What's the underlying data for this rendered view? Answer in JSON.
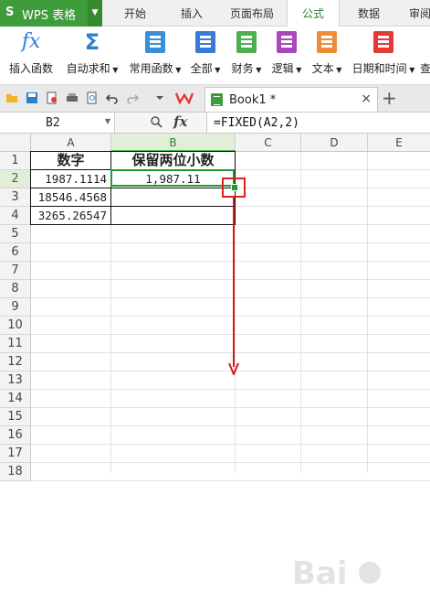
{
  "app": {
    "brand": "WPS 表格",
    "brand_logo": "S",
    "accent": "#3e9c3a"
  },
  "tabs": [
    "开始",
    "插入",
    "页面布局",
    "公式",
    "数据",
    "审阅"
  ],
  "active_tab": "公式",
  "ribbon": [
    {
      "label": "插入函数",
      "icon": "fx-icon",
      "has_dropdown": false,
      "color": "#2f7fd1"
    },
    {
      "label": "自动求和",
      "icon": "sigma-icon",
      "has_dropdown": true,
      "color": "#2f7fd1"
    },
    {
      "label": "常用函数",
      "icon": "star-book-icon",
      "has_dropdown": true,
      "color": "#3a8fd9"
    },
    {
      "label": "全部",
      "icon": "all-functions-icon",
      "has_dropdown": true,
      "color": "#3a7bd5"
    },
    {
      "label": "财务",
      "icon": "finance-icon",
      "has_dropdown": true,
      "color": "#4caf50"
    },
    {
      "label": "逻辑",
      "icon": "logic-icon",
      "has_dropdown": true,
      "color": "#ab47bc"
    },
    {
      "label": "文本",
      "icon": "text-icon",
      "has_dropdown": true,
      "color": "#ef8c3b"
    },
    {
      "label": "日期和时间",
      "icon": "clock-icon",
      "has_dropdown": true,
      "color": "#e53935"
    },
    {
      "label": "查",
      "icon": "lookup-icon",
      "has_dropdown": false,
      "color": "#2f7fd1"
    }
  ],
  "quick_access_icons": [
    "folder-icon",
    "save-icon",
    "print-preview-icon",
    "print-icon",
    "preview-icon",
    "undo-icon",
    "redo-icon",
    "customize-dropdown-icon",
    "wps-logo-icon"
  ],
  "document_tab": {
    "name": "Book1 *",
    "close": "×",
    "new_tab": "+"
  },
  "formula_bar": {
    "cell_ref": "B2",
    "formula": "=FIXED(A2,2)"
  },
  "sheet": {
    "columns": [
      "A",
      "B",
      "C",
      "D",
      "E"
    ],
    "selected_column": "B",
    "selected_row": "2",
    "rows": [
      "1",
      "2",
      "3",
      "4",
      "5",
      "6",
      "7",
      "8",
      "9",
      "10",
      "11",
      "12",
      "13",
      "14",
      "15",
      "16",
      "17",
      "18"
    ],
    "header": {
      "a": "数字",
      "b": "保留两位小数"
    },
    "data": [
      {
        "a": "1987.1114",
        "b": "1,987.11"
      },
      {
        "a": "18546.4568",
        "b": ""
      },
      {
        "a": "3265.26547",
        "b": ""
      }
    ]
  },
  "annotation_colors": {
    "selection": "#1e9b35",
    "highlight": "#e02020",
    "arrow": "#d21c1c"
  }
}
